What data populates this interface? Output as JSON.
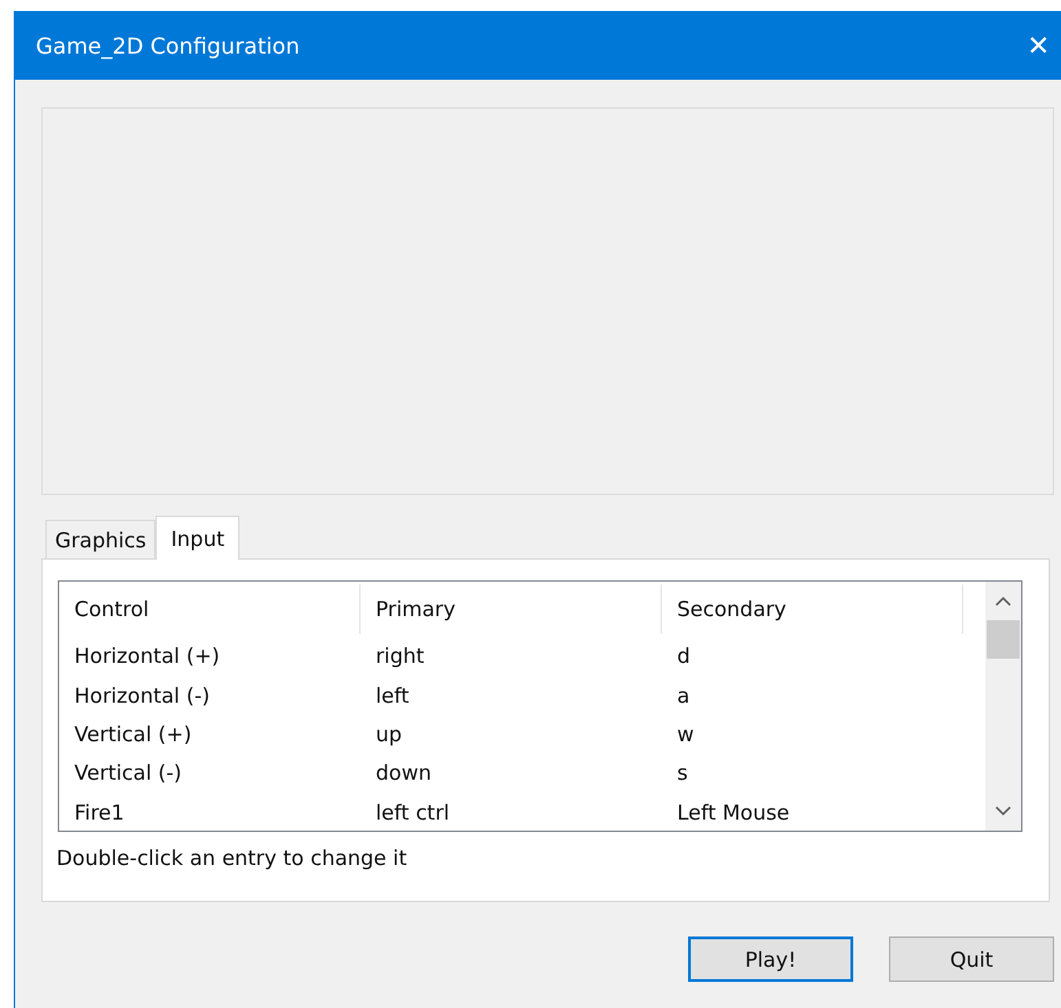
{
  "window": {
    "title": "Game_2D Configuration",
    "close": "✕"
  },
  "tabs": [
    {
      "label": "Graphics",
      "selected": false
    },
    {
      "label": "Input",
      "selected": true
    }
  ],
  "table": {
    "columns": [
      "Control",
      "Primary",
      "Secondary"
    ],
    "rows": [
      [
        "Horizontal (+)",
        "right",
        "d"
      ],
      [
        "Horizontal (-)",
        "left",
        "a"
      ],
      [
        "Vertical (+)",
        "up",
        "w"
      ],
      [
        "Vertical (-)",
        "down",
        "s"
      ],
      [
        "Fire1",
        "left ctrl",
        "Left Mouse"
      ]
    ]
  },
  "hint": "Double-click an entry to change it",
  "buttons": [
    {
      "label": "Play!",
      "default": true
    },
    {
      "label": "Quit",
      "default": false
    }
  ]
}
